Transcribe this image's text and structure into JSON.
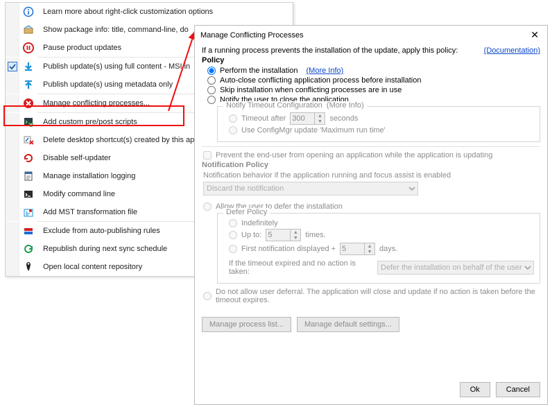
{
  "menu": {
    "items": [
      {
        "icon": "info",
        "label": "Learn more about right-click customization options"
      },
      {
        "icon": "package",
        "label": "Show package info: title, command-line, do"
      },
      {
        "icon": "pause",
        "label": "Pause product updates"
      },
      {
        "sep": true
      },
      {
        "checked": true,
        "icon": "download",
        "label": "Publish update(s) using full content - MSI in"
      },
      {
        "icon": "upload",
        "label": "Publish update(s) using metadata only"
      },
      {
        "sep": true
      },
      {
        "icon": "deny",
        "label": "Manage conflicting processes...",
        "highlight": true
      },
      {
        "sep": true
      },
      {
        "icon": "script",
        "label": "Add custom pre/post scripts"
      },
      {
        "icon": "del-shortcut",
        "label": "Delete desktop shortcut(s) created by this ap"
      },
      {
        "icon": "refresh",
        "label": "Disable self-updater"
      },
      {
        "icon": "log",
        "label": "Manage installation logging"
      },
      {
        "icon": "cmd",
        "label": "Modify command line"
      },
      {
        "icon": "mst",
        "label": "Add MST transformation file"
      },
      {
        "sep": true
      },
      {
        "icon": "exclude",
        "label": "Exclude from auto-publishing rules"
      },
      {
        "icon": "republish",
        "label": "Republish during next sync schedule"
      },
      {
        "icon": "repo",
        "label": "Open local content repository"
      }
    ]
  },
  "dialog": {
    "title": "Manage Conflicting Processes",
    "intro": "If a running process prevents the installation of the update, apply this policy:",
    "doc_link": "(Documentation)",
    "policy_head": "Policy",
    "opt_perform": "Perform the installation",
    "more_info": "(More Info)",
    "opt_autoclose": "Auto-close conflicting application process before installation",
    "opt_skip": "Skip installation when conflicting processes are in use",
    "opt_notify": "Notify the user to close the application.",
    "notify_group": "Notify Timeout Configuration",
    "notify_more": "(More Info)",
    "timeout_label": "Timeout after",
    "timeout_value": "300",
    "timeout_seconds": "seconds",
    "use_configmgr": "Use ConfigMgr update 'Maximum run time'",
    "prevent_open": "Prevent the end-user from opening an application while the application is updating",
    "notif_policy_head": "Notification Policy",
    "notif_policy_desc": "Notification behavior if the application running and focus assist is enabled",
    "notif_select": "Discard the notification",
    "allow_defer": "Allow the user to defer the installation",
    "defer_group": "Defer Policy",
    "defer_indef": "Indefinitely",
    "defer_upto": "Up to:",
    "defer_upto_val": "5",
    "defer_times": "times.",
    "defer_first": "First notification displayed +",
    "defer_first_val": "5",
    "defer_days": "days.",
    "timeout_expired": "If the timeout expired and no action is taken:",
    "timeout_select": "Defer the installation on behalf of the user",
    "deny_defer": "Do not allow user deferral. The application will close and update if no action is taken before the timeout expires.",
    "btn_proc": "Manage process list...",
    "btn_defaults": "Manage default settings...",
    "btn_ok": "Ok",
    "btn_cancel": "Cancel"
  }
}
